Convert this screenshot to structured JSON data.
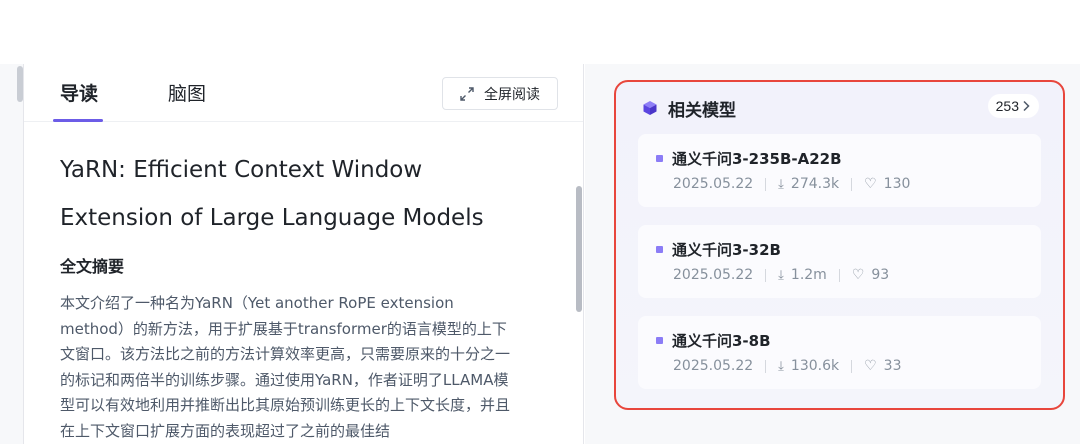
{
  "tabs": {
    "guide": "导读",
    "mindmap": "脑图"
  },
  "fullscreen": {
    "label": "全屏阅读"
  },
  "paper": {
    "title_line1": "YaRN: Efficient Context Window",
    "title_line2": "Extension of Large Language Models",
    "section_heading": "全文摘要",
    "abstract": "本文介绍了一种名为YaRN（Yet another RoPE extension method）的新方法，用于扩展基于transformer的语言模型的上下文窗口。该方法比之前的方法计算效率更高，只需要原来的十分之一的标记和两倍半的训练步骤。通过使用YaRN，作者证明了LLAMA模型可以有效地利用并推断出比其原始预训练更长的上下文长度，并且在上下文窗口扩展方面的表现超过了之前的最佳结"
  },
  "related_models": {
    "title": "相关模型",
    "count": "253",
    "items": [
      {
        "name": "通义千问3-235B-A22B",
        "date": "2025.05.22",
        "downloads": "274.3k",
        "likes": "130"
      },
      {
        "name": "通义千问3-32B",
        "date": "2025.05.22",
        "downloads": "1.2m",
        "likes": "93"
      },
      {
        "name": "通义千问3-8B",
        "date": "2025.05.22",
        "downloads": "130.6k",
        "likes": "33"
      }
    ]
  },
  "colors": {
    "accent": "#6c5ce7",
    "highlight_border": "#e8463c",
    "bullet": "#8b7cf6"
  },
  "icons": {
    "fullscreen": "expand-arrows-icon",
    "models": "cube-icon",
    "count_more": "chevron-right-icon",
    "downloads": "download-icon",
    "likes": "heart-icon"
  }
}
